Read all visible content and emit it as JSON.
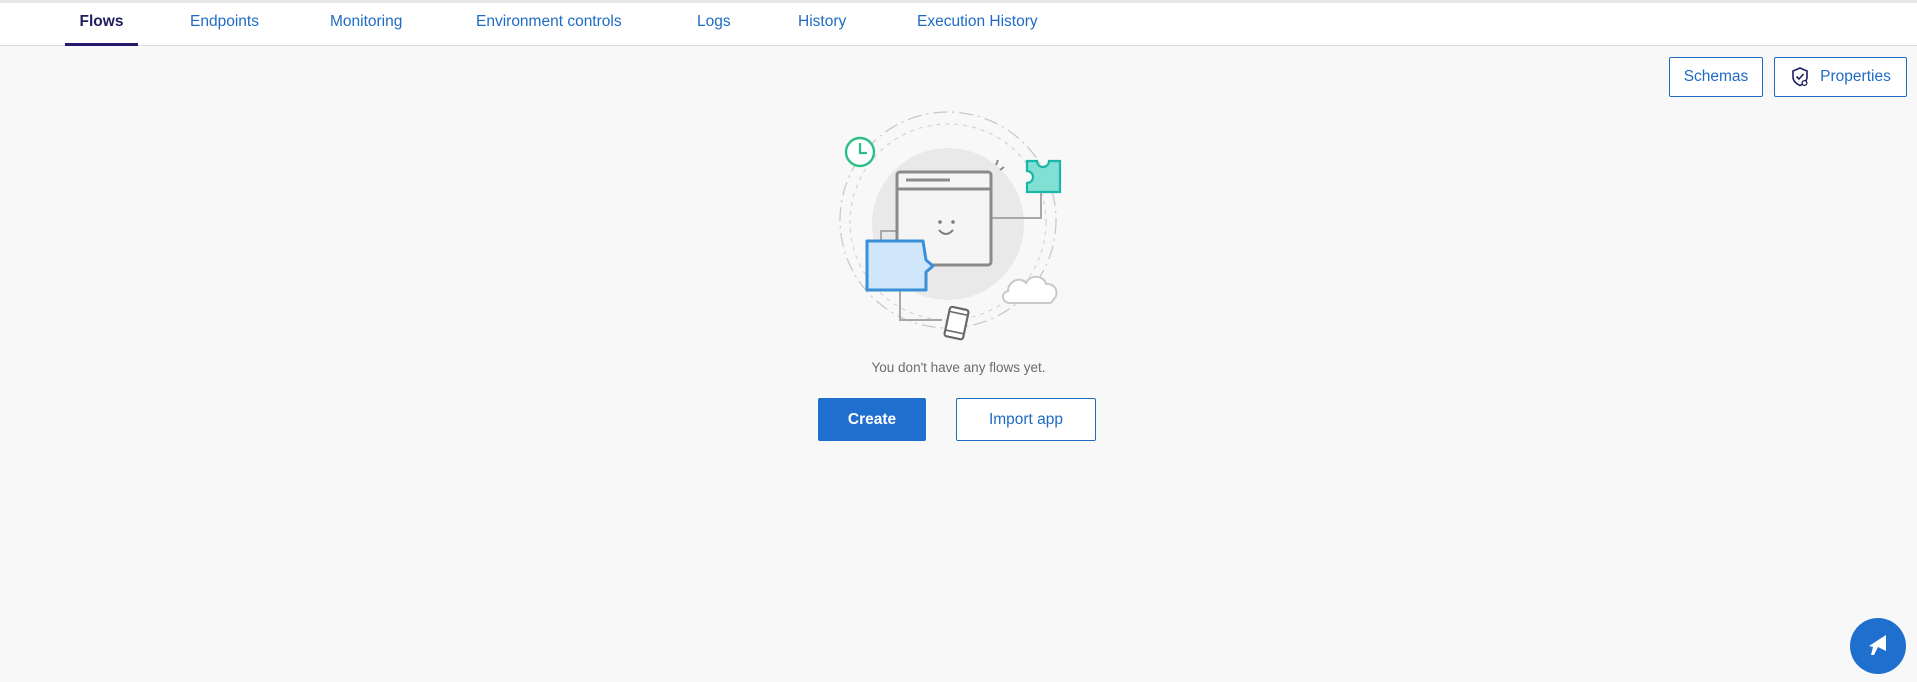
{
  "tabs": {
    "flows": "Flows",
    "endpoints": "Endpoints",
    "monitoring": "Monitoring",
    "environment_controls": "Environment controls",
    "logs": "Logs",
    "history": "History",
    "execution_history": "Execution History",
    "active": "Flows"
  },
  "toolbar": {
    "schemas_label": "Schemas",
    "properties_label": "Properties",
    "properties_icon": "shield-check-icon"
  },
  "empty_state": {
    "illustration": "flows-empty-illustration",
    "message": "You don't have any flows yet.",
    "create_label": "Create",
    "import_label": "Import app"
  },
  "fab": {
    "icon": "megaphone-icon"
  },
  "colors": {
    "accent": "#1f6fcf",
    "link": "#1f6bc4",
    "active_tab_underline": "#231a6e",
    "background": "#f8f8f8"
  }
}
